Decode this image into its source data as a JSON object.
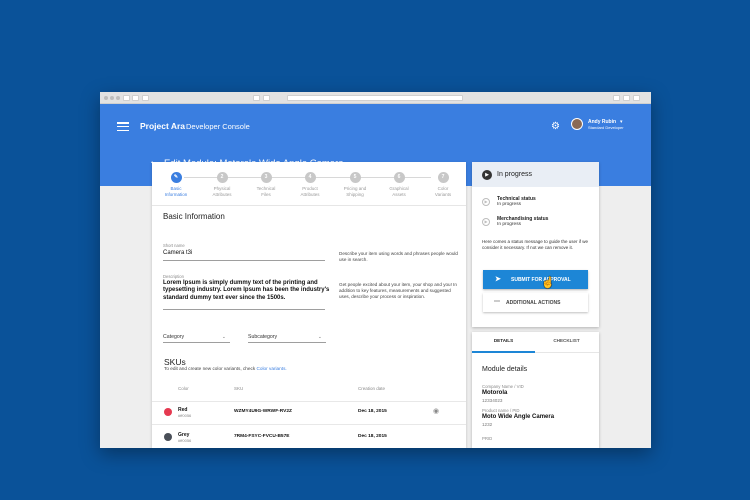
{
  "app": {
    "name": "Project Ara",
    "subtitle": "Developer Console",
    "user_name": "Andy Rubin",
    "user_role": "Standard Developer"
  },
  "page": {
    "title": "Edit Module: Motorola Wide Angle Camera"
  },
  "steps": [
    {
      "num": "",
      "label1": "Basic",
      "label2": "Information",
      "active": true
    },
    {
      "num": "2",
      "label1": "Physical",
      "label2": "Attributes"
    },
    {
      "num": "3",
      "label1": "Technical",
      "label2": "Files"
    },
    {
      "num": "4",
      "label1": "Product",
      "label2": "Attributes"
    },
    {
      "num": "5",
      "label1": "Pricing and",
      "label2": "Shipping"
    },
    {
      "num": "6",
      "label1": "Graphical",
      "label2": "Assets"
    },
    {
      "num": "7",
      "label1": "Color",
      "label2": "Variants"
    }
  ],
  "form": {
    "section_title": "Basic Information",
    "short_name_label": "Short name",
    "short_name_value": "Camera t3i",
    "short_name_help": "Describe your item using words and phrases people would use in search.",
    "description_label": "Description",
    "description_value": "Lorem Ipsum is simply dummy text of the printing and typesetting industry. Lorem Ipsum has been the industry's standard dummy text ever since the 1500s.",
    "description_help": "Get people excited about your item, your shop and you! In addition to key features, measurements and suggested uses, describe your process or inspiration.",
    "category_placeholder": "Category",
    "subcategory_placeholder": "Subcategory"
  },
  "skus": {
    "title": "SKUs",
    "help_text": "To edit and create new color variants, check ",
    "help_link": "Color variants.",
    "columns": {
      "color": "Color",
      "sku": "SKU",
      "date": "Creation date"
    },
    "rows": [
      {
        "name": "Red",
        "hex": "#ff0056",
        "sku": "WZMY4U9G-WRWF-RV2Z",
        "date": "Dec 18, 2015",
        "swatch": "#e53950"
      },
      {
        "name": "Grey",
        "hex": "#ff0056",
        "sku": "7RM4-FSYC-FVCU-B57E",
        "date": "Dec 18, 2015",
        "swatch": "#4a4f58"
      }
    ]
  },
  "status_panel": {
    "status": "In progress",
    "technical_title": "Technical status",
    "technical_value": "In progress",
    "merch_title": "Merchandising status",
    "merch_value": "In progress",
    "message": "Here comes a status message to guide the user if we consider it necessary. If not we can remove it.",
    "submit_label": "SUBMIT FOR APPROVAL",
    "more_label": "ADDITIONAL ACTIONS"
  },
  "details_panel": {
    "tab_details": "DETAILS",
    "tab_checklist": "CHECKLIST",
    "section_title": "Module details",
    "company_label": "Company Name / VID",
    "company_value": "Motorola",
    "company_id": "12334023",
    "product_label": "Product name / PID",
    "product_value": "Moto Wide Angle Camera",
    "product_id": "1232",
    "extra_label": "PRID"
  }
}
